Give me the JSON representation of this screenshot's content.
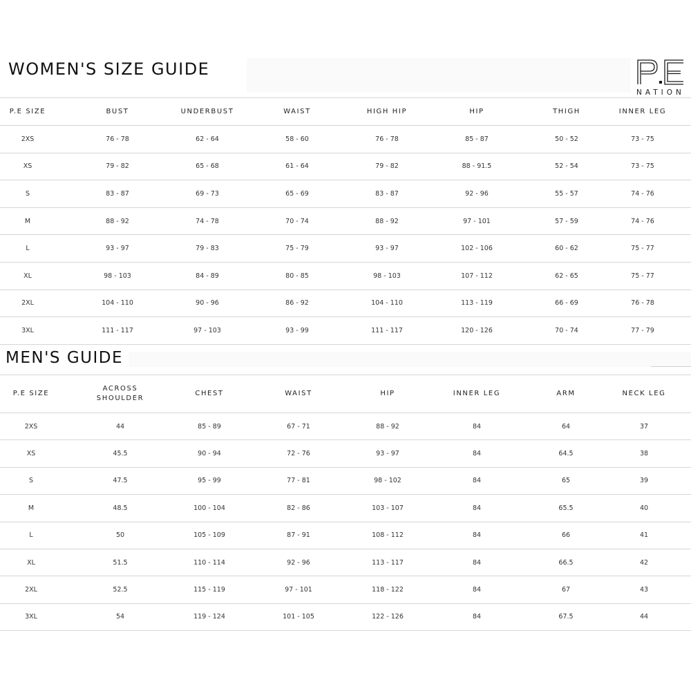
{
  "brand": {
    "logo_text": "P.E",
    "logo_subtext": "NATION"
  },
  "women": {
    "title": "WOMEN'S SIZE GUIDE",
    "headers": [
      "P.E SIZE",
      "BUST",
      "UNDERBUST",
      "WAIST",
      "HIGH HIP",
      "HIP",
      "THIGH",
      "INNER LEG"
    ],
    "rows": [
      [
        "2XS",
        "76 - 78",
        "62 - 64",
        "58 - 60",
        "76 - 78",
        "85 - 87",
        "50 - 52",
        "73 - 75"
      ],
      [
        "XS",
        "79 - 82",
        "65 - 68",
        "61 - 64",
        "79 - 82",
        "88 - 91.5",
        "52 - 54",
        "73 - 75"
      ],
      [
        "S",
        "83 - 87",
        "69 - 73",
        "65 - 69",
        "83 - 87",
        "92 - 96",
        "55 - 57",
        "74 - 76"
      ],
      [
        "M",
        "88 - 92",
        "74 - 78",
        "70 - 74",
        "88 - 92",
        "97 - 101",
        "57 - 59",
        "74 - 76"
      ],
      [
        "L",
        "93 - 97",
        "79 - 83",
        "75 - 79",
        "93 - 97",
        "102 - 106",
        "60 - 62",
        "75 - 77"
      ],
      [
        "XL",
        "98 - 103",
        "84 - 89",
        "80 - 85",
        "98 - 103",
        "107 - 112",
        "62 - 65",
        "75 - 77"
      ],
      [
        "2XL",
        "104 - 110",
        "90 - 96",
        "86 - 92",
        "104 - 110",
        "113 - 119",
        "66 - 69",
        "76 - 78"
      ],
      [
        "3XL",
        "111 - 117",
        "97 - 103",
        "93 - 99",
        "111 - 117",
        "120 - 126",
        "70 - 74",
        "77 - 79"
      ]
    ]
  },
  "men": {
    "title": "MEN'S GUIDE",
    "headers": [
      "P.E SIZE",
      "ACROSS SHOULDER",
      "CHEST",
      "WAIST",
      "HIP",
      "INNER LEG",
      "ARM",
      "NECK LEG"
    ],
    "rows": [
      [
        "2XS",
        "44",
        "85 - 89",
        "67 - 71",
        "88 - 92",
        "84",
        "64",
        "37"
      ],
      [
        "XS",
        "45.5",
        "90 - 94",
        "72 - 76",
        "93 - 97",
        "84",
        "64.5",
        "38"
      ],
      [
        "S",
        "47.5",
        "95 - 99",
        "77 - 81",
        "98 - 102",
        "84",
        "65",
        "39"
      ],
      [
        "M",
        "48.5",
        "100 - 104",
        "82 - 86",
        "103 - 107",
        "84",
        "65.5",
        "40"
      ],
      [
        "L",
        "50",
        "105 - 109",
        "87 - 91",
        "108 - 112",
        "84",
        "66",
        "41"
      ],
      [
        "XL",
        "51.5",
        "110 - 114",
        "92 - 96",
        "113 - 117",
        "84",
        "66.5",
        "42"
      ],
      [
        "2XL",
        "52.5",
        "115 - 119",
        "97 - 101",
        "118 - 122",
        "84",
        "67",
        "43"
      ],
      [
        "3XL",
        "54",
        "119 - 124",
        "101 - 105",
        "122 - 126",
        "84",
        "67.5",
        "44"
      ]
    ]
  }
}
